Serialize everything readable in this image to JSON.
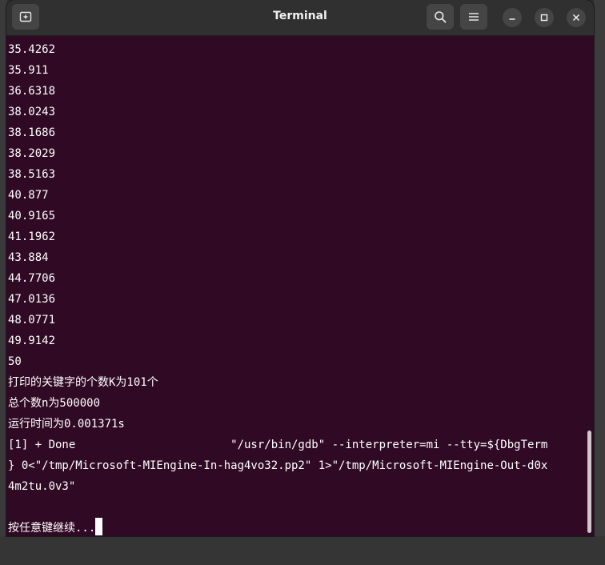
{
  "window": {
    "title": "Terminal"
  },
  "icons": {
    "new_tab": "new-tab-icon",
    "search": "search-icon",
    "menu": "hamburger-menu-icon",
    "minimize": "minimize-icon",
    "maximize": "maximize-icon",
    "close": "close-icon"
  },
  "colors": {
    "terminal_background": "#300a24",
    "titlebar": "#303030",
    "text": "#ffffff"
  },
  "terminal": {
    "lines": [
      "35.4262",
      "35.911",
      "36.6318",
      "38.0243",
      "38.1686",
      "38.2029",
      "38.5163",
      "40.877",
      "40.9165",
      "41.1962",
      "43.884",
      "44.7706",
      "47.0136",
      "48.0771",
      "49.9142",
      "50",
      "打印的关键字的个数K为101个",
      "总个数n为500000",
      "运行时间为0.001371s",
      "[1] + Done                       \"/usr/bin/gdb\" --interpreter=mi --tty=${DbgTerm",
      "} 0<\"/tmp/Microsoft-MIEngine-In-hag4vo32.pp2\" 1>\"/tmp/Microsoft-MIEngine-Out-d0x",
      "4m2tu.0v3\"",
      "",
      "按任意键继续..."
    ]
  }
}
